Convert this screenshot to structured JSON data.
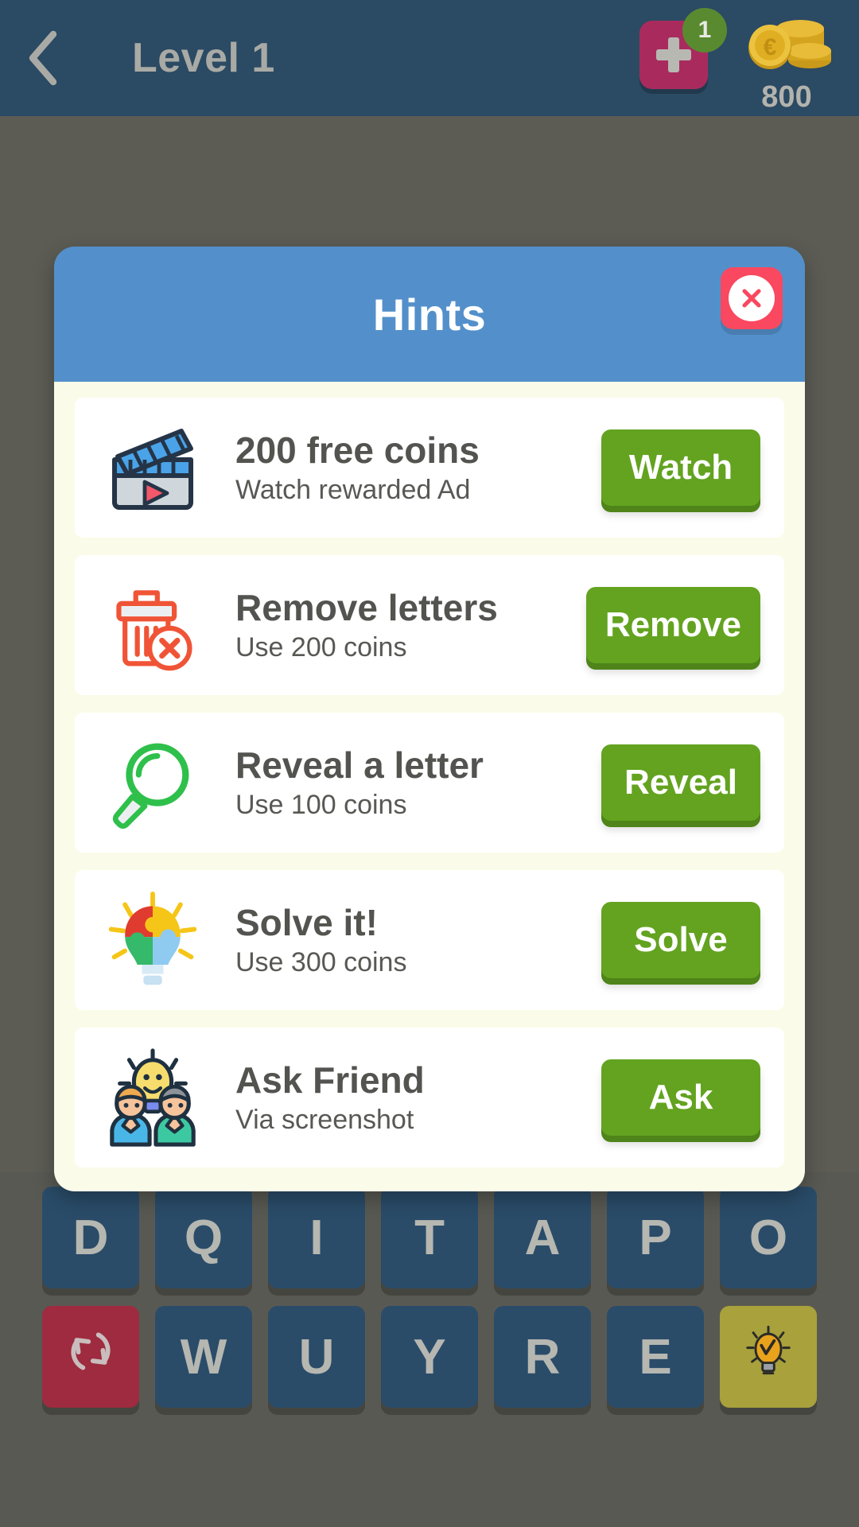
{
  "header": {
    "back_icon": "chevron-left-icon",
    "title": "Level 1",
    "add_coins_icon": "plus-icon",
    "add_badge_count": "1",
    "coin_icon": "coin-stack-euro-icon",
    "coin_count": "800"
  },
  "dialog": {
    "title": "Hints",
    "close_icon": "close-x-icon",
    "hints": [
      {
        "icon": "movie-clapperboard-icon",
        "title": "200 free coins",
        "subtitle": "Watch rewarded Ad",
        "action_label": "Watch"
      },
      {
        "icon": "trash-delete-icon",
        "title": "Remove letters",
        "subtitle": "Use 200 coins",
        "action_label": "Remove"
      },
      {
        "icon": "magnifying-glass-icon",
        "title": "Reveal a letter",
        "subtitle": "Use 100 coins",
        "action_label": "Reveal"
      },
      {
        "icon": "puzzle-lightbulb-icon",
        "title": "Solve it!",
        "subtitle": "Use 300 coins",
        "action_label": "Solve"
      },
      {
        "icon": "ask-friend-people-icon",
        "title": "Ask Friend",
        "subtitle": "Via screenshot",
        "action_label": "Ask"
      }
    ]
  },
  "keyboard": {
    "row1": [
      "D",
      "Q",
      "I",
      "T",
      "A",
      "P",
      "O"
    ],
    "row2_shuffle_icon": "shuffle-refresh-icon",
    "row2": [
      "W",
      "U",
      "Y",
      "R",
      "E"
    ],
    "row2_hint_icon": "lightbulb-hint-icon"
  },
  "colors": {
    "topbar": "#2b4a63",
    "dialog_header": "#5390cb",
    "dialog_body": "#fbfbe9",
    "action_green": "#63a320",
    "close_red": "#f9485f",
    "add_magenta": "#a92b5e",
    "badge_green": "#5a8a30",
    "key_blue": "#2a4c69",
    "shuffle_red": "#9e2b3f",
    "hintkey_olive": "#a8a13c"
  }
}
